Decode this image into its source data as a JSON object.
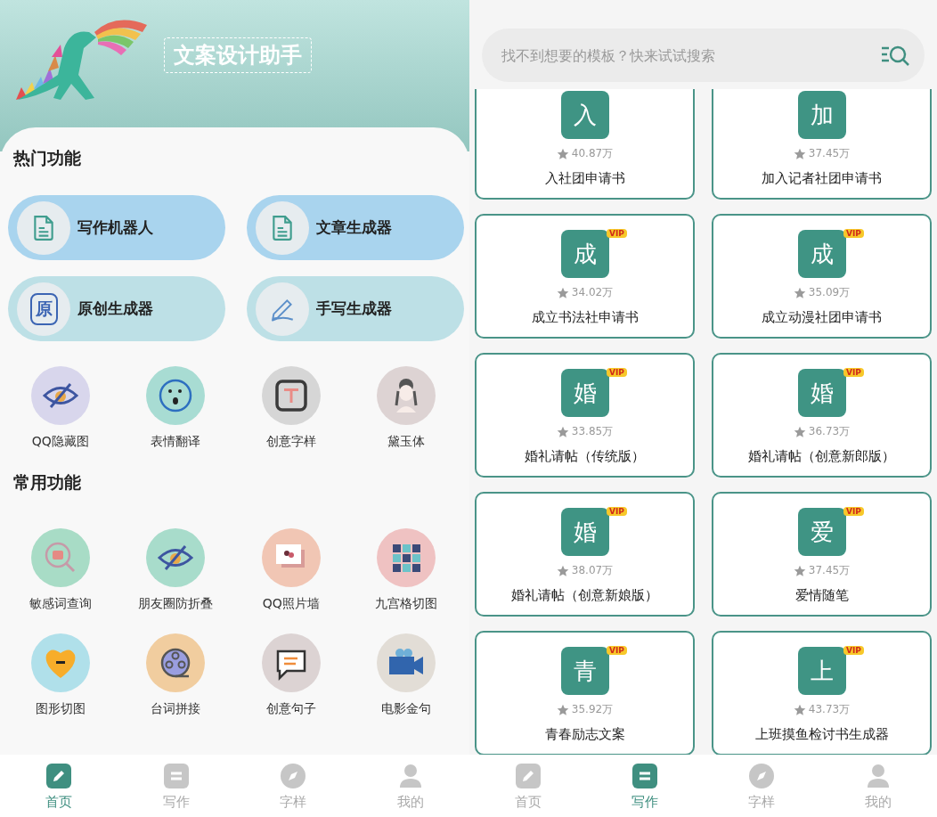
{
  "left": {
    "header": {
      "title": "文案设计助手"
    },
    "hot_section": {
      "title": "热门功能"
    },
    "hot_buttons": [
      {
        "label": "写作机器人",
        "kind": "doc",
        "color": "#a9d4ee"
      },
      {
        "label": "文章生成器",
        "kind": "doc",
        "color": "#a9d4ee"
      },
      {
        "label": "原创生成器",
        "kind": "seal",
        "glyph": "原",
        "color": "#bde0e6"
      },
      {
        "label": "手写生成器",
        "kind": "pen",
        "color": "#bde0e6"
      }
    ],
    "hot_tools": [
      {
        "label": "QQ隐藏图",
        "kind": "eye",
        "color": "#d8d6ec"
      },
      {
        "label": "表情翻译",
        "kind": "face",
        "color": "#a8dcd3"
      },
      {
        "label": "创意字样",
        "kind": "frame",
        "color": "#d6d6d6"
      },
      {
        "label": "黛玉体",
        "kind": "figure",
        "color": "#ddd3d3"
      }
    ],
    "common_section": {
      "title": "常用功能"
    },
    "common_tools": [
      {
        "label": "敏感词查询",
        "kind": "magnifier",
        "color": "#a8dcc6"
      },
      {
        "label": "朋友圈防折叠",
        "kind": "eye",
        "color": "#a8dccb"
      },
      {
        "label": "QQ照片墙",
        "kind": "photos",
        "color": "#f1c6b4"
      },
      {
        "label": "九宫格切图",
        "kind": "grid",
        "color": "#efc2c2"
      },
      {
        "label": "图形切图",
        "kind": "heart",
        "color": "#b0e0ea"
      },
      {
        "label": "台词拼接",
        "kind": "film",
        "color": "#f1cd9f"
      },
      {
        "label": "创意句子",
        "kind": "chat",
        "color": "#dcd3d3"
      },
      {
        "label": "电影金句",
        "kind": "camera",
        "color": "#e2ddd6"
      }
    ],
    "nav": [
      {
        "label": "首页",
        "kind": "pencil",
        "selected": true
      },
      {
        "label": "写作",
        "kind": "lines",
        "selected": false
      },
      {
        "label": "字样",
        "kind": "compass",
        "selected": false
      },
      {
        "label": "我的",
        "kind": "person",
        "selected": false
      }
    ]
  },
  "right": {
    "search": {
      "placeholder": "找不到想要的模板？快来试试搜索"
    },
    "templates": [
      {
        "char": "入",
        "rating": "40.87万",
        "title": "入社团申请书"
      },
      {
        "char": "加",
        "rating": "37.45万",
        "title": "加入记者社团申请书"
      },
      {
        "char": "成",
        "badge": "VIP",
        "rating": "34.02万",
        "title": "成立书法社申请书"
      },
      {
        "char": "成",
        "badge": "VIP",
        "rating": "35.09万",
        "title": "成立动漫社团申请书"
      },
      {
        "char": "婚",
        "badge": "VIP",
        "rating": "33.85万",
        "title": "婚礼请帖（传统版）"
      },
      {
        "char": "婚",
        "badge": "VIP",
        "rating": "36.73万",
        "title": "婚礼请帖（创意新郎版）"
      },
      {
        "char": "婚",
        "badge": "VIP",
        "rating": "38.07万",
        "title": "婚礼请帖（创意新娘版）"
      },
      {
        "char": "爱",
        "badge": "VIP",
        "rating": "37.45万",
        "title": "爱情随笔"
      },
      {
        "char": "青",
        "badge": "VIP",
        "rating": "35.92万",
        "title": "青春励志文案"
      },
      {
        "char": "上",
        "badge": "VIP",
        "rating": "43.73万",
        "title": "上班摸鱼检讨书生成器"
      }
    ],
    "nav": [
      {
        "label": "首页",
        "kind": "pencil",
        "selected": false
      },
      {
        "label": "写作",
        "kind": "lines",
        "selected": true
      },
      {
        "label": "字样",
        "kind": "compass",
        "selected": false
      },
      {
        "label": "我的",
        "kind": "person",
        "selected": false
      }
    ]
  }
}
